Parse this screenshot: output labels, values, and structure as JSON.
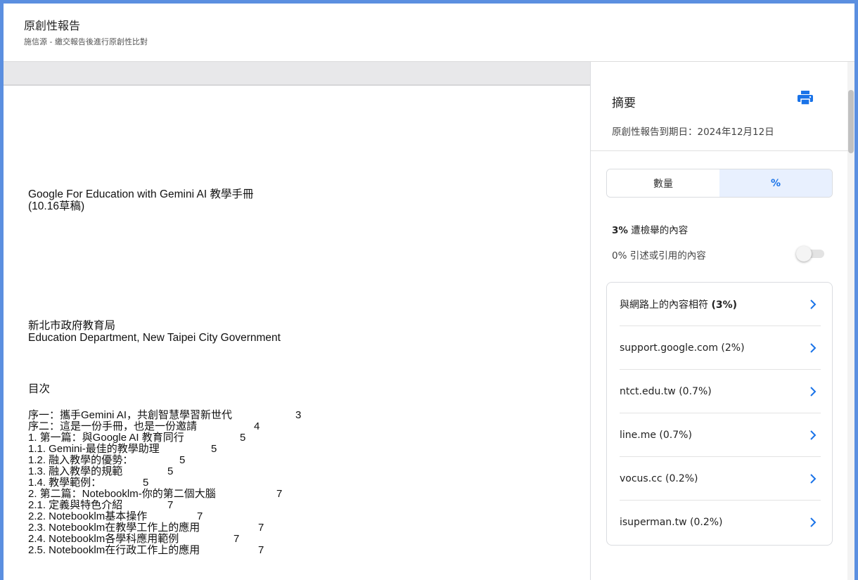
{
  "header": {
    "title": "原創性報告",
    "subtitle": "施信源 - 繳交報告後進行原創性比對"
  },
  "document": {
    "title_line1": "Google For Education with Gemini AI 教學手冊",
    "title_line2": "(10.16草稿)",
    "org_line1": "新北市政府教育局",
    "org_line2": "Education Department, New Taipei City Government",
    "toc_heading": "目次",
    "toc": [
      {
        "text": "序一：攜手Gemini AI，共創智慧學習新世代",
        "page": "3"
      },
      {
        "text": "序二：這是一份手冊，也是一份邀請",
        "page": "4"
      },
      {
        "text": "1. 第一篇：與Google AI 教育同行",
        "page": "5"
      },
      {
        "text": "1.1. Gemini-最佳的教學助理",
        "page": "5"
      },
      {
        "text": "1.2. 融入教學的優勢：",
        "page": "5"
      },
      {
        "text": "1.3. 融入教學的規範",
        "page": "5"
      },
      {
        "text": "1.4. 教學範例：",
        "page": "5"
      },
      {
        "text": "2. 第二篇：Notebooklm-你的第二個大腦",
        "page": "7"
      },
      {
        "text": "2.1. 定義與特色介紹",
        "page": "7"
      },
      {
        "text": "2.2. Notebooklm基本操作",
        "page": "7"
      },
      {
        "text": "2.3. Notebooklm在教學工作上的應用",
        "page": "7"
      },
      {
        "text": "2.4. Notebooklm各學科應用範例",
        "page": "7"
      },
      {
        "text": "2.5. Notebooklm在行政工作上的應用",
        "page": "7"
      }
    ]
  },
  "summary": {
    "title": "摘要",
    "print_icon": "print-icon",
    "due_date": "原創性報告到期日：2024年12月12日",
    "tabs": [
      {
        "label": "數量",
        "active": false
      },
      {
        "label": "%",
        "active": true
      }
    ],
    "flagged_pct": "3%",
    "flagged_label": " 遭檢舉的內容",
    "quoted_pct": "0%",
    "quoted_label": " 引述或引用的內容",
    "quoted_toggle_on": false,
    "matches": [
      {
        "label": "與網路上的內容相符 ",
        "pct": "(3%)",
        "bold_pct": true
      },
      {
        "label": "support.google.com (2%)",
        "pct": ""
      },
      {
        "label": "ntct.edu.tw (0.7%)",
        "pct": ""
      },
      {
        "label": "line.me (0.7%)",
        "pct": ""
      },
      {
        "label": "vocus.cc (0.2%)",
        "pct": ""
      },
      {
        "label": "isuperman.tw (0.2%)",
        "pct": ""
      }
    ],
    "accent_color": "#1a73e8"
  }
}
